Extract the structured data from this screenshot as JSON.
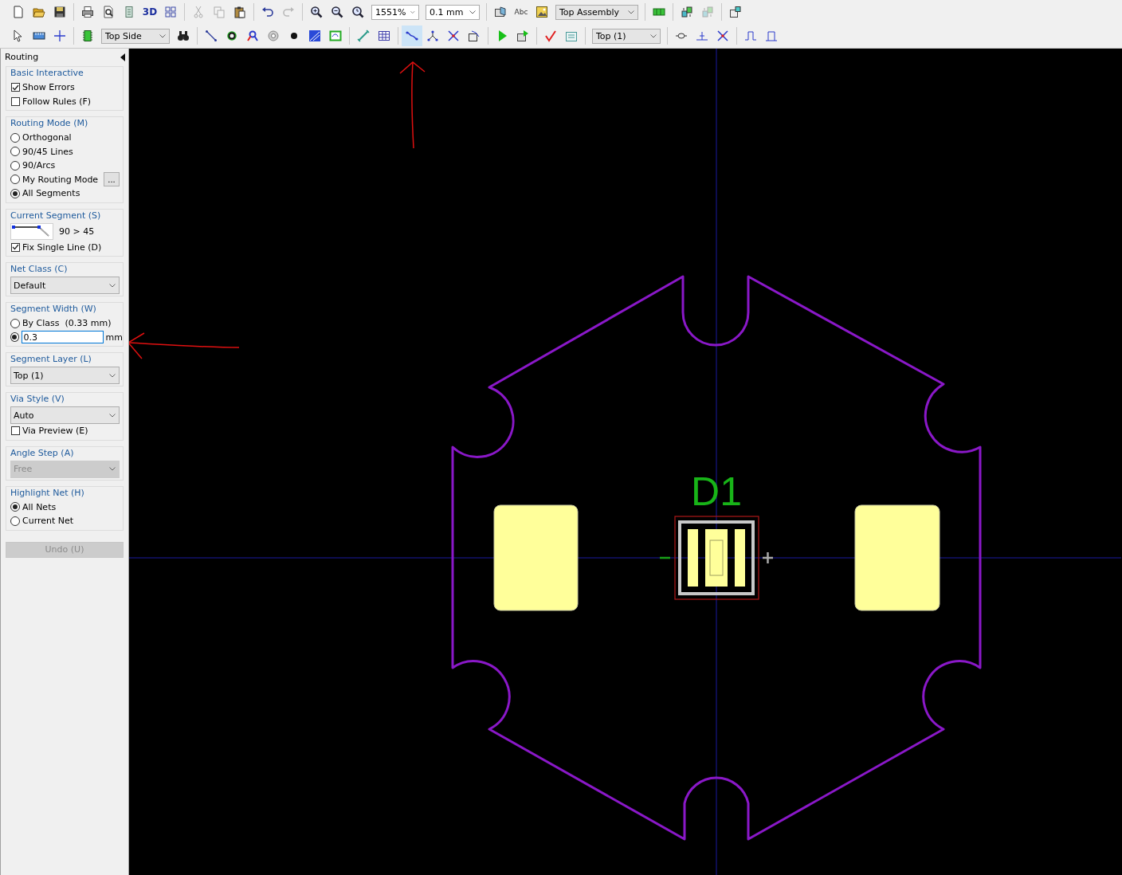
{
  "toolbars": [
    {
      "items": [
        {
          "kind": "button",
          "disabled": false
        },
        {
          "kind": "button",
          "disabled": false
        },
        {
          "kind": "button",
          "disabled": false
        },
        {
          "kind": "separator"
        },
        {
          "kind": "button",
          "disabled": false
        },
        {
          "kind": "button",
          "disabled": false
        },
        {
          "kind": "button",
          "disabled": false
        },
        {
          "kind": "text",
          "label": "3D",
          "disabled": false
        },
        {
          "kind": "button",
          "disabled": false
        },
        {
          "kind": "separator"
        },
        {
          "kind": "button",
          "disabled": true
        },
        {
          "kind": "button",
          "disabled": true
        },
        {
          "kind": "button",
          "disabled": false
        },
        {
          "kind": "separator"
        },
        {
          "kind": "button",
          "disabled": false
        },
        {
          "kind": "button",
          "disabled": true
        },
        {
          "kind": "separator"
        },
        {
          "kind": "button",
          "disabled": false
        },
        {
          "kind": "button",
          "disabled": false
        },
        {
          "kind": "button",
          "disabled": false
        },
        {
          "kind": "dropdown",
          "value": "1551%"
        },
        {
          "kind": "dropdown",
          "value": "0.1 mm"
        },
        {
          "kind": "separator"
        },
        {
          "kind": "button",
          "disabled": false
        },
        {
          "kind": "text",
          "label": "Abc",
          "disabled": false
        },
        {
          "kind": "button",
          "disabled": false
        },
        {
          "kind": "dropdown",
          "value": "Top Assembly"
        },
        {
          "kind": "separator"
        },
        {
          "kind": "button",
          "disabled": false
        },
        {
          "kind": "separator"
        },
        {
          "kind": "button",
          "disabled": false
        },
        {
          "kind": "button",
          "disabled": true
        },
        {
          "kind": "separator"
        },
        {
          "kind": "button",
          "disabled": false
        }
      ]
    },
    {
      "items": [
        {
          "kind": "button",
          "disabled": false,
          "selected": false
        },
        {
          "kind": "button",
          "disabled": false,
          "selected": false
        },
        {
          "kind": "button",
          "disabled": false,
          "selected": false
        },
        {
          "kind": "separator"
        },
        {
          "kind": "button",
          "disabled": false,
          "selected": false
        },
        {
          "kind": "dropdown",
          "value": "Top Side"
        },
        {
          "kind": "button",
          "disabled": false
        },
        {
          "kind": "separator"
        },
        {
          "kind": "button",
          "disabled": false,
          "selected": false
        },
        {
          "kind": "button",
          "disabled": false,
          "selected": false
        },
        {
          "kind": "button",
          "disabled": false,
          "selected": false
        },
        {
          "kind": "button",
          "disabled": false,
          "selected": false
        },
        {
          "kind": "button",
          "disabled": false,
          "selected": false
        },
        {
          "kind": "button",
          "disabled": false,
          "selected": false
        },
        {
          "kind": "button",
          "disabled": false,
          "selected": false
        },
        {
          "kind": "separator"
        },
        {
          "kind": "button",
          "disabled": false,
          "selected": false
        },
        {
          "kind": "button",
          "disabled": false,
          "selected": false
        },
        {
          "kind": "separator"
        },
        {
          "kind": "button",
          "disabled": false,
          "selected": true
        },
        {
          "kind": "button",
          "disabled": false,
          "selected": false
        },
        {
          "kind": "button",
          "disabled": false,
          "selected": false
        },
        {
          "kind": "button",
          "disabled": false,
          "selected": false
        },
        {
          "kind": "separator"
        },
        {
          "kind": "button",
          "disabled": false
        },
        {
          "kind": "button",
          "disabled": false
        },
        {
          "kind": "separator"
        },
        {
          "kind": "button",
          "disabled": false
        },
        {
          "kind": "button",
          "disabled": false
        },
        {
          "kind": "separator"
        },
        {
          "kind": "dropdown",
          "value": "Top (1)"
        },
        {
          "kind": "separator"
        },
        {
          "kind": "button",
          "disabled": false
        },
        {
          "kind": "button",
          "disabled": false
        },
        {
          "kind": "button",
          "disabled": false
        },
        {
          "kind": "separator"
        },
        {
          "kind": "button",
          "disabled": false
        },
        {
          "kind": "button",
          "disabled": false
        }
      ]
    }
  ],
  "panel": {
    "title": "Routing",
    "sections": [
      {
        "title": "Basic Interactive",
        "rows": [
          {
            "kind": "checkbox",
            "label": "Show Errors",
            "checked": true
          },
          {
            "kind": "checkbox",
            "label": "Follow Rules (F)",
            "checked": false
          }
        ]
      },
      {
        "title": "Routing Mode (M)",
        "rows": [
          {
            "kind": "radio",
            "label": "Orthogonal",
            "selected": false
          },
          {
            "kind": "radio",
            "label": "90/45 Lines",
            "selected": false
          },
          {
            "kind": "radio",
            "label": "90/Arcs",
            "selected": false
          },
          {
            "kind": "radio",
            "label": "My Routing Mode",
            "selected": false,
            "button": "..."
          },
          {
            "kind": "radio",
            "label": "All Segments",
            "selected": true
          }
        ]
      },
      {
        "title": "Current Segment (S)",
        "rows": [
          {
            "kind": "segment",
            "reading": "90 > 45"
          },
          {
            "kind": "checkbox",
            "label": "Fix Single Line (D)",
            "checked": true
          }
        ]
      },
      {
        "title": "Net Class (C)",
        "rows": [
          {
            "kind": "dropdown",
            "value": "Default",
            "disabled": false
          }
        ]
      },
      {
        "title": "Segment Width (W)",
        "rows": [
          {
            "kind": "radio",
            "label": "By Class  (0.33 mm)",
            "selected": false
          },
          {
            "kind": "radio_input",
            "value": "0.3",
            "unit": "mm",
            "selected": true
          }
        ]
      },
      {
        "title": "Segment Layer (L)",
        "rows": [
          {
            "kind": "dropdown",
            "value": "Top (1)",
            "disabled": false
          }
        ]
      },
      {
        "title": "Via Style (V)",
        "rows": [
          {
            "kind": "dropdown",
            "value": "Auto",
            "disabled": false
          },
          {
            "kind": "checkbox",
            "label": "Via Preview (E)",
            "checked": false
          }
        ]
      },
      {
        "title": "Angle Step (A)",
        "rows": [
          {
            "kind": "dropdown",
            "value": "Free",
            "disabled": true
          }
        ]
      },
      {
        "title": "Highlight Net (H)",
        "rows": [
          {
            "kind": "radio",
            "label": "All Nets",
            "selected": true
          },
          {
            "kind": "radio",
            "label": "Current Net",
            "selected": false
          }
        ]
      }
    ],
    "undo_button": {
      "label": "Undo (U)",
      "disabled": true
    }
  },
  "canvas": {
    "designator": "D1"
  }
}
